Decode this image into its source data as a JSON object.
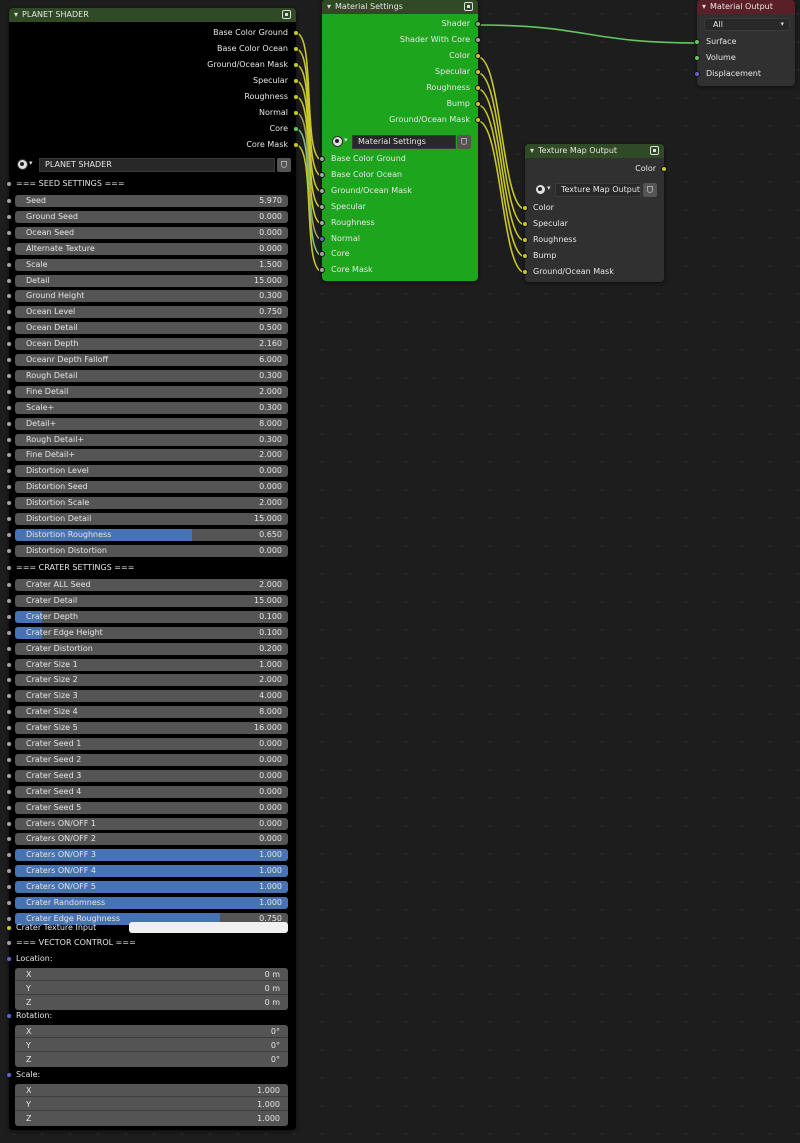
{
  "planet_shader": {
    "title": "PLANET SHADER",
    "outputs": [
      "Base Color Ground",
      "Base Color Ocean",
      "Ground/Ocean Mask",
      "Specular",
      "Roughness",
      "Normal",
      "Core",
      "Core Mask"
    ],
    "group_name": "PLANET SHADER",
    "seed_header": "=== SEED SETTINGS ===",
    "seed_fields": [
      {
        "label": "Seed",
        "value": "5.970",
        "fill": 0
      },
      {
        "label": "Ground Seed",
        "value": "0.000",
        "fill": 0
      },
      {
        "label": "Ocean Seed",
        "value": "0.000",
        "fill": 0
      },
      {
        "label": "Alternate Texture",
        "value": "0.000",
        "fill": 0
      },
      {
        "label": "Scale",
        "value": "1.500",
        "fill": 0
      },
      {
        "label": "Detail",
        "value": "15.000",
        "fill": 0
      },
      {
        "label": "Ground Height",
        "value": "0.300",
        "fill": 0
      },
      {
        "label": "Ocean Level",
        "value": "0.750",
        "fill": 0
      },
      {
        "label": "Ocean Detail",
        "value": "0.500",
        "fill": 0
      },
      {
        "label": "Ocean Depth",
        "value": "2.160",
        "fill": 0
      },
      {
        "label": "Oceanr Depth Falloff",
        "value": "6.000",
        "fill": 0
      },
      {
        "label": "Rough Detail",
        "value": "0.300",
        "fill": 0
      },
      {
        "label": "Fine Detail",
        "value": "2.000",
        "fill": 0
      },
      {
        "label": "Scale+",
        "value": "0.300",
        "fill": 0
      },
      {
        "label": "Detail+",
        "value": "8.000",
        "fill": 0
      },
      {
        "label": "Rough Detail+",
        "value": "0.300",
        "fill": 0
      },
      {
        "label": "Fine Detail+",
        "value": "2.000",
        "fill": 0
      },
      {
        "label": "Distortion Level",
        "value": "0.000",
        "fill": 0
      },
      {
        "label": "Distortion Seed",
        "value": "0.000",
        "fill": 0
      },
      {
        "label": "Distortion Scale",
        "value": "2.000",
        "fill": 0
      },
      {
        "label": "Distortion Detail",
        "value": "15.000",
        "fill": 0
      },
      {
        "label": "Distortion Roughness",
        "value": "0.650",
        "fill": 0.65
      },
      {
        "label": "Distortion Distortion",
        "value": "0.000",
        "fill": 0
      }
    ],
    "crater_header": "=== CRATER SETTINGS ===",
    "crater_fields": [
      {
        "label": "Crater ALL Seed",
        "value": "2.000",
        "fill": 0
      },
      {
        "label": "Crater Detail",
        "value": "15.000",
        "fill": 0
      },
      {
        "label": "Crater Depth",
        "value": "0.100",
        "fill": 0.1
      },
      {
        "label": "Crater Edge Height",
        "value": "0.100",
        "fill": 0.1
      },
      {
        "label": "Crater Distortion",
        "value": "0.200",
        "fill": 0
      },
      {
        "label": "Crater Size 1",
        "value": "1.000",
        "fill": 0
      },
      {
        "label": "Crater Size 2",
        "value": "2.000",
        "fill": 0
      },
      {
        "label": "Crater Size 3",
        "value": "4.000",
        "fill": 0
      },
      {
        "label": "Crater Size 4",
        "value": "8.000",
        "fill": 0
      },
      {
        "label": "Crater Size 5",
        "value": "16.000",
        "fill": 0
      },
      {
        "label": "Crater Seed 1",
        "value": "0.000",
        "fill": 0
      },
      {
        "label": "Crater Seed 2",
        "value": "0.000",
        "fill": 0
      },
      {
        "label": "Crater Seed 3",
        "value": "0.000",
        "fill": 0
      },
      {
        "label": "Crater Seed 4",
        "value": "0.000",
        "fill": 0
      },
      {
        "label": "Crater Seed 5",
        "value": "0.000",
        "fill": 0
      },
      {
        "label": "Craters ON/OFF 1",
        "value": "0.000",
        "fill": 0
      },
      {
        "label": "Craters ON/OFF 2",
        "value": "0.000",
        "fill": 0
      },
      {
        "label": "Craters ON/OFF 3",
        "value": "1.000",
        "fill": 1
      },
      {
        "label": "Craters ON/OFF 4",
        "value": "1.000",
        "fill": 1
      },
      {
        "label": "Craters ON/OFF 5",
        "value": "1.000",
        "fill": 1
      },
      {
        "label": "Crater Randomness",
        "value": "1.000",
        "fill": 1
      },
      {
        "label": "Crater Edge Roughness",
        "value": "0.750",
        "fill": 0.75
      }
    ],
    "crater_texture_label": "Crater Texture Input",
    "vector_header": "=== VECTOR CONTROL ===",
    "location_label": "Location:",
    "location": [
      {
        "axis": "X",
        "value": "0 m"
      },
      {
        "axis": "Y",
        "value": "0 m"
      },
      {
        "axis": "Z",
        "value": "0 m"
      }
    ],
    "rotation_label": "Rotation:",
    "rotation": [
      {
        "axis": "X",
        "value": "0°"
      },
      {
        "axis": "Y",
        "value": "0°"
      },
      {
        "axis": "Z",
        "value": "0°"
      }
    ],
    "scale_label": "Scale:",
    "scale": [
      {
        "axis": "X",
        "value": "1.000"
      },
      {
        "axis": "Y",
        "value": "1.000"
      },
      {
        "axis": "Z",
        "value": "1.000"
      }
    ]
  },
  "material_settings": {
    "title": "Material Settings",
    "outputs": [
      "Shader",
      "Shader With Core",
      "Color",
      "Specular",
      "Roughness",
      "Bump",
      "Ground/Ocean Mask"
    ],
    "group_name": "Material Settings",
    "inputs": [
      "Base Color Ground",
      "Base Color Ocean",
      "Ground/Ocean Mask",
      "Specular",
      "Roughness",
      "Normal",
      "Core",
      "Core Mask"
    ]
  },
  "texture_map_output": {
    "title": "Texture Map Output",
    "output": "Color",
    "group_name": "Texture Map Output",
    "inputs": [
      "Color",
      "Specular",
      "Roughness",
      "Bump",
      "Ground/Ocean Mask"
    ]
  },
  "material_output": {
    "title": "Material Output",
    "target": "All",
    "inputs": [
      "Surface",
      "Volume",
      "Displacement"
    ]
  },
  "colors": {
    "node_header": "#2f4a24",
    "material_output_header": "#5a1f27",
    "material_settings_body": "#1da61d",
    "slider_fill": "#4772b3",
    "float_socket": "#a1a1a1",
    "color_socket": "#c7c729",
    "shader_socket": "#63c763",
    "vector_socket": "#6363c7"
  }
}
